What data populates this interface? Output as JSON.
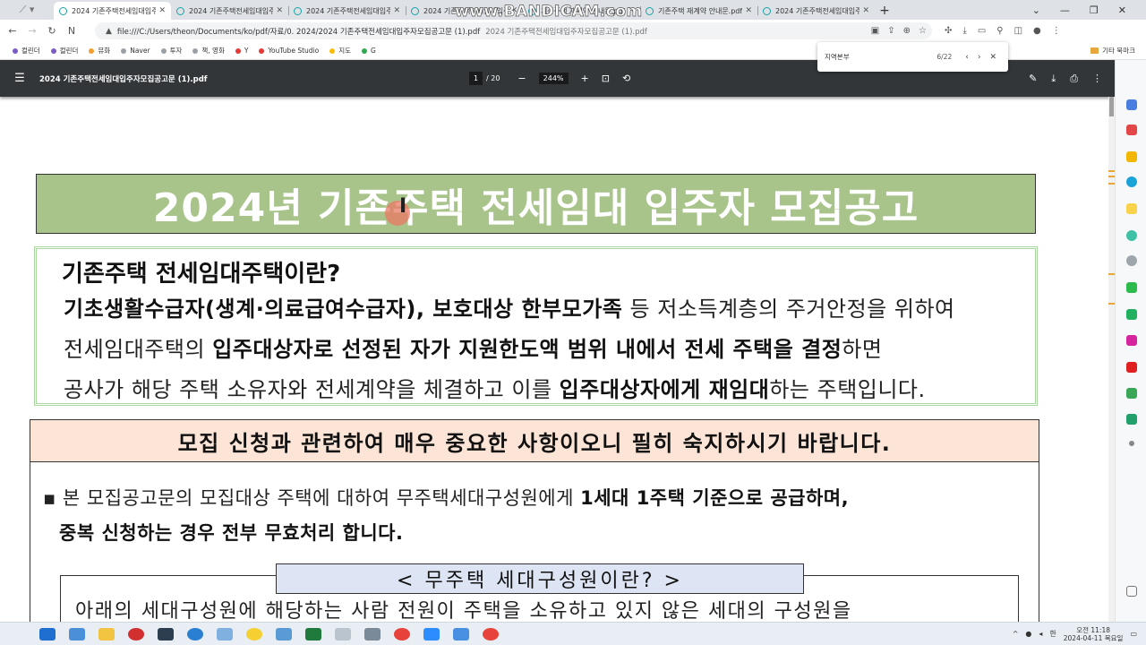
{
  "browser": {
    "tabs": [
      {
        "title": "2024 기존주택전세임대입주자",
        "active": true
      },
      {
        "title": "2024 기존주택전세임대입주자",
        "active": false
      },
      {
        "title": "2024 기존주택전세임대입주자",
        "active": false
      },
      {
        "title": "2024 기존주택전세임대입주자",
        "active": false
      },
      {
        "title": "기존주택 재계약 안내문.pdf",
        "active": false
      },
      {
        "title": "기존주택 재계약 안내문.pdf",
        "active": false
      },
      {
        "title": "2024 기존주택전세임대입주자",
        "active": false
      }
    ],
    "new_tab": "+",
    "url": "file:///C:/Users/theon/Documents/ko/pdf/자료/0. 2024/2024 기존주택전세임대입주자모집공고문 (1).pdf",
    "url_title": "2024 기존주택전세임대입주자모집공고문 (1).pdf",
    "bookmarks": [
      {
        "label": "컬린더",
        "color": "#7b5cc4"
      },
      {
        "label": "컬린더",
        "color": "#7b5cc4"
      },
      {
        "label": "뮤화",
        "color": "#f0a030"
      },
      {
        "label": "Naver",
        "color": "#9aa0a6"
      },
      {
        "label": "투자",
        "color": "#9aa0a6"
      },
      {
        "label": "책, 영화",
        "color": "#9aa0a6"
      },
      {
        "label": "Y",
        "color": "#e53935"
      },
      {
        "label": "YouTube Studio",
        "color": "#e53935"
      },
      {
        "label": "지도",
        "color": "#fbbc05"
      },
      {
        "label": "G",
        "color": "#34a853"
      }
    ],
    "bookmarks_other": "기타 북마크"
  },
  "find": {
    "query": "지역본부",
    "count": "6/22"
  },
  "pdf": {
    "filename": "2024 기존주택전세임대입주자모집공고문 (1).pdf",
    "page_current": "1",
    "page_total": "/ 20",
    "zoom": "244%"
  },
  "watermark": "www.BANDICAM.com",
  "document": {
    "title": "2024년 기존주택 전세임대 입주자 모집공고",
    "def_heading": "기존주택 전세임대주택이란?",
    "def_line1_b1": "기초생활수급자(생계·의료급여수급자), 보호대상 한부모가족",
    "def_line1_t1": " 등 저소득계층의 주거안정을 위하여",
    "def_line2_t1": "전세임대주택의 ",
    "def_line2_b1": "입주대상자로 선정된 자가 지원한도액 범위 내에서 전세 주택을 결정",
    "def_line2_t2": "하면",
    "def_line3_t1": "공사가 해당 주택 소유자와 전세계약을 체결하고 이를 ",
    "def_line3_b1": "입주대상자에게 재임대",
    "def_line3_t2": "하는 주택입니다.",
    "notice": "모집 신청과 관련하여 매우 중요한 사항이오니 필히 숙지하시기 바랍니다.",
    "bullet_mark": "▪",
    "bullet_t1": "본 모집공고문의 모집대상 주택에 대하여 무주택세대구성원에게 ",
    "bullet_b1": "1세대 1주택 기준으로 공급하며,",
    "bullet_b2": "중복 신청하는 경우 전부 무효처리 합니다.",
    "subhead": "< 무주택 세대구성원이란? >",
    "inner_line": "아래의 세대구성원에 해당하는 사람 전원이 주택을 소유하고 있지 않은 세대의 구성원을"
  },
  "taskbar": {
    "time": "오전 11:18",
    "date": "2024-04-11 목요일",
    "ime": "한"
  }
}
